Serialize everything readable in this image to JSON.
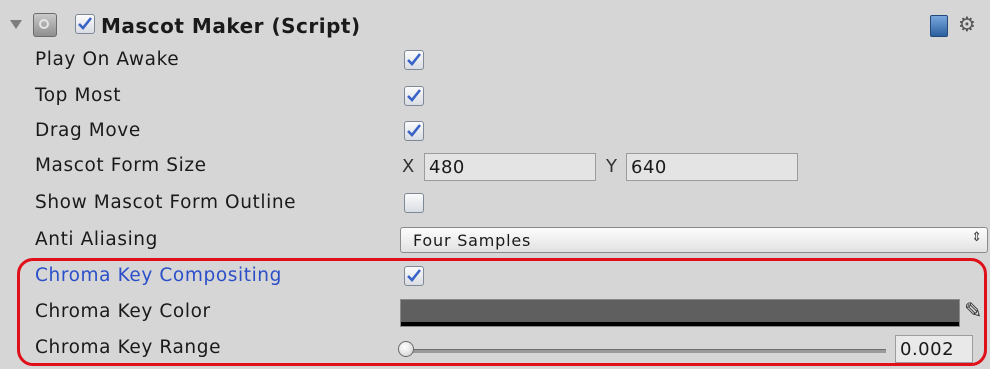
{
  "component": {
    "title": "Mascot Maker (Script)",
    "enabled": true
  },
  "properties": {
    "play_on_awake": {
      "label": "Play On Awake",
      "checked": true
    },
    "top_most": {
      "label": "Top Most",
      "checked": true
    },
    "drag_move": {
      "label": "Drag Move",
      "checked": true
    },
    "mascot_form_size": {
      "label": "Mascot Form Size",
      "x_label": "X",
      "x_value": "480",
      "y_label": "Y",
      "y_value": "640"
    },
    "show_mascot_form_outline": {
      "label": "Show Mascot Form Outline",
      "checked": false
    },
    "anti_aliasing": {
      "label": "Anti Aliasing",
      "selected": "Four Samples"
    },
    "chroma_key_compositing": {
      "label": "Chroma Key Compositing",
      "checked": true
    },
    "chroma_key_color": {
      "label": "Chroma Key Color",
      "color": "#5f5f5f"
    },
    "chroma_key_range": {
      "label": "Chroma Key Range",
      "value": "0.002"
    }
  },
  "icons": {
    "foldout": "foldout-triangle-icon",
    "script": "script-component-icon",
    "help": "help-book-icon",
    "settings": "gear-icon",
    "color_picker": "eyedropper-icon"
  },
  "colors": {
    "highlight": "#e0101a",
    "modified_label": "#2b4fc9"
  }
}
